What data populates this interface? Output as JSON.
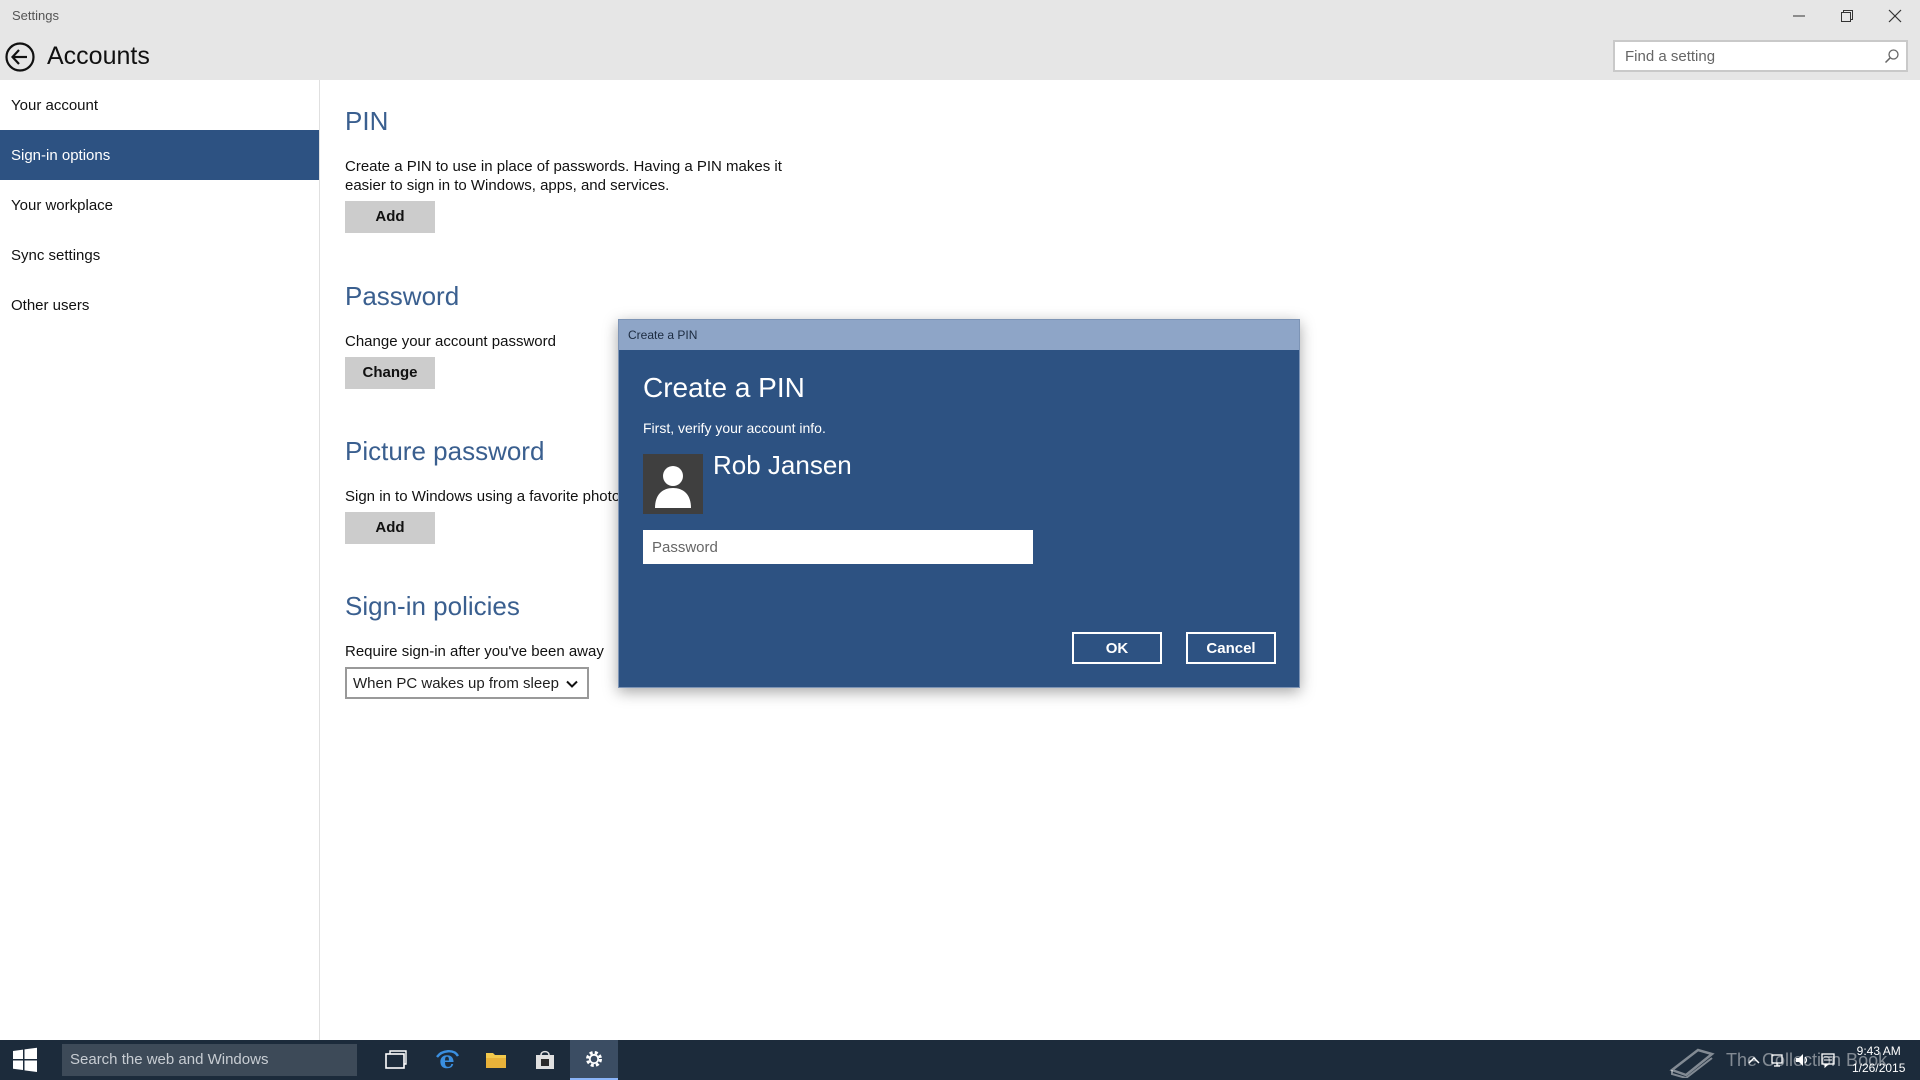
{
  "window": {
    "app_title": "Settings"
  },
  "header": {
    "page_title": "Accounts",
    "search_placeholder": "Find a setting"
  },
  "sidebar": {
    "items": [
      {
        "label": "Your account"
      },
      {
        "label": "Sign-in options",
        "active": true
      },
      {
        "label": "Your workplace"
      },
      {
        "label": "Sync settings"
      },
      {
        "label": "Other users"
      }
    ]
  },
  "main": {
    "pin": {
      "title": "PIN",
      "description": "Create a PIN to use in place of passwords. Having a PIN makes it easier to sign in to Windows, apps, and services.",
      "button": "Add"
    },
    "password": {
      "title": "Password",
      "description": "Change your account password",
      "button": "Change"
    },
    "picture_password": {
      "title": "Picture password",
      "description": "Sign in to Windows using a favorite photo",
      "button": "Add"
    },
    "sign_in_policies": {
      "title": "Sign-in policies",
      "description": "Require sign-in after you've been away",
      "selected": "When PC wakes up from sleep"
    }
  },
  "dialog": {
    "window_title": "Create a PIN",
    "heading": "Create a PIN",
    "subtitle": "First, verify your account info.",
    "user_name": "Rob Jansen",
    "password_placeholder": "Password",
    "ok_label": "OK",
    "cancel_label": "Cancel"
  },
  "taskbar": {
    "search_placeholder": "Search the web and Windows",
    "watermark": "The Collection Book",
    "time": "9:43 AM",
    "date": "1/26/2015"
  },
  "colors": {
    "accent": "#2d5282",
    "dialog_titlebar": "#8ea5c7",
    "header_bg": "#e6e6e6",
    "taskbar_bg": "#1c2b3b"
  },
  "icons": [
    "back-arrow-icon",
    "search-icon",
    "minimize-icon",
    "restore-icon",
    "close-icon",
    "chevron-down-icon",
    "user-avatar-icon",
    "windows-logo-icon",
    "task-view-icon",
    "edge-browser-icon",
    "file-explorer-icon",
    "store-icon",
    "settings-gear-icon"
  ]
}
